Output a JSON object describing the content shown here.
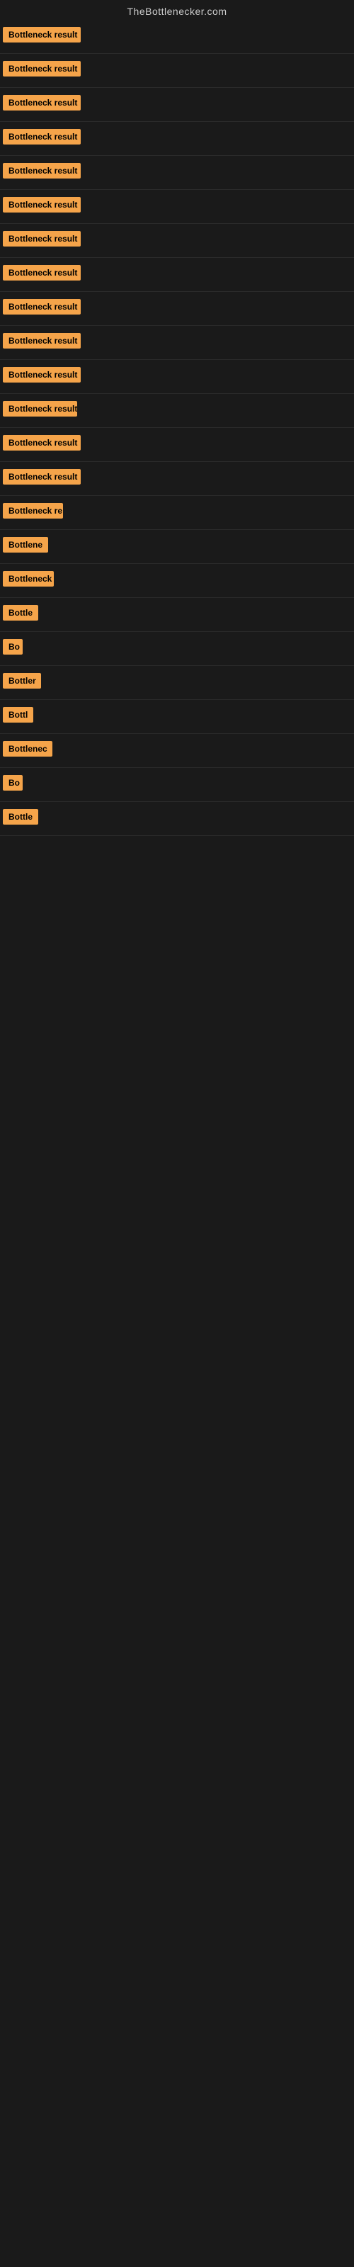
{
  "site": {
    "title": "TheBottlenecker.com"
  },
  "rows": [
    {
      "id": 1,
      "label": "Bottleneck result",
      "width": 110
    },
    {
      "id": 2,
      "label": "Bottleneck result",
      "width": 110
    },
    {
      "id": 3,
      "label": "Bottleneck result",
      "width": 110
    },
    {
      "id": 4,
      "label": "Bottleneck result",
      "width": 110
    },
    {
      "id": 5,
      "label": "Bottleneck result",
      "width": 110
    },
    {
      "id": 6,
      "label": "Bottleneck result",
      "width": 110
    },
    {
      "id": 7,
      "label": "Bottleneck result",
      "width": 110
    },
    {
      "id": 8,
      "label": "Bottleneck result",
      "width": 110
    },
    {
      "id": 9,
      "label": "Bottleneck result",
      "width": 110
    },
    {
      "id": 10,
      "label": "Bottleneck result",
      "width": 110
    },
    {
      "id": 11,
      "label": "Bottleneck result",
      "width": 110
    },
    {
      "id": 12,
      "label": "Bottleneck result",
      "width": 105
    },
    {
      "id": 13,
      "label": "Bottleneck result",
      "width": 110
    },
    {
      "id": 14,
      "label": "Bottleneck result",
      "width": 110
    },
    {
      "id": 15,
      "label": "Bottleneck re",
      "width": 85
    },
    {
      "id": 16,
      "label": "Bottlene",
      "width": 65
    },
    {
      "id": 17,
      "label": "Bottleneck",
      "width": 72
    },
    {
      "id": 18,
      "label": "Bottle",
      "width": 52
    },
    {
      "id": 19,
      "label": "Bo",
      "width": 28
    },
    {
      "id": 20,
      "label": "Bottler",
      "width": 54
    },
    {
      "id": 21,
      "label": "Bottl",
      "width": 45
    },
    {
      "id": 22,
      "label": "Bottlenec",
      "width": 70
    },
    {
      "id": 23,
      "label": "Bo",
      "width": 28
    },
    {
      "id": 24,
      "label": "Bottle",
      "width": 52
    }
  ]
}
